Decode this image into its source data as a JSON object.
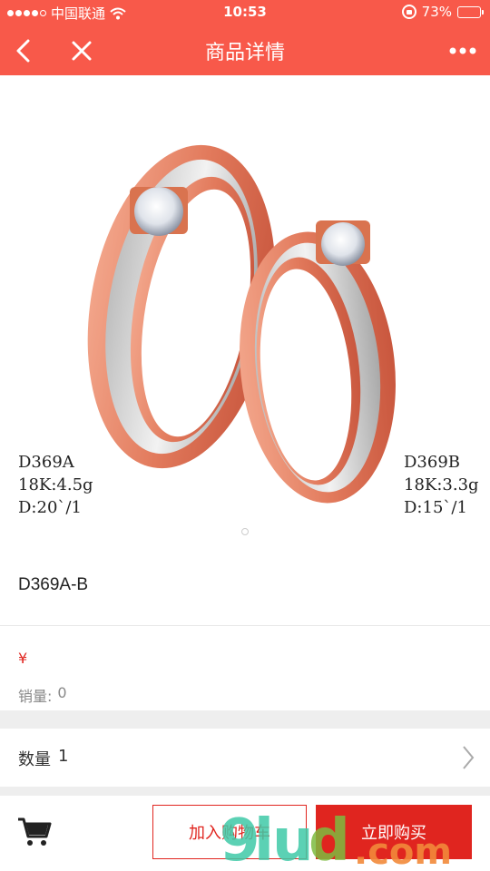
{
  "status_bar": {
    "carrier": "中国联通",
    "time": "10:53",
    "battery": "73%",
    "battery_level": 0.73,
    "signal_bars": 4,
    "signal_total": 5
  },
  "nav": {
    "title": "商品详情",
    "back_icon": "chevron-left-icon",
    "close_icon": "close-icon",
    "more_icon": "more-dots-icon"
  },
  "product_image": {
    "left_caption": [
      "D369A",
      "18K:4.5g",
      "D:20`/1"
    ],
    "right_caption": [
      "D369B",
      "18K:3.3g",
      "D:15`/1"
    ]
  },
  "product": {
    "title": "D369A-B",
    "price_symbol": "¥",
    "sales_label": "销量:",
    "sales_value": "0",
    "quantity_label": "数量",
    "quantity_value": "1"
  },
  "bottom_bar": {
    "cart_icon": "cart-icon",
    "add_to_cart": "加入购物车",
    "buy_now": "立即购买"
  },
  "watermark": {
    "text": "9lud.com"
  },
  "colors": {
    "accent": "#f8594a",
    "price_red": "#e0251f",
    "band_gray": "#eeeeee"
  }
}
